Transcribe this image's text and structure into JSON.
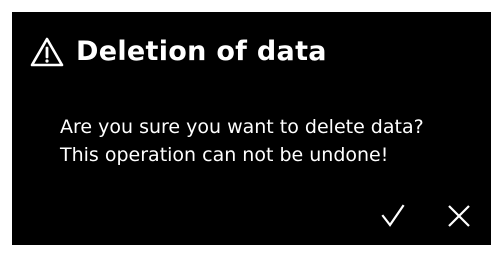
{
  "dialog": {
    "title": "Deletion of data",
    "title_icon": "warning-triangle-icon",
    "message_line1": "Are you sure you want to delete data?",
    "message_line2": "This operation can not be undone!",
    "confirm_icon": "checkmark-icon",
    "cancel_icon": "close-icon",
    "background_color": "#000000",
    "text_color": "#ffffff"
  }
}
